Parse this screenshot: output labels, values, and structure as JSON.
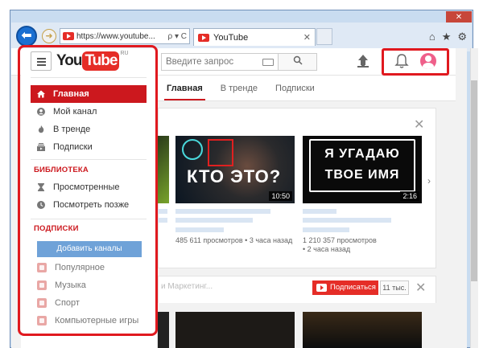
{
  "browser": {
    "url": "https://www.youtube...",
    "tab_title": "YouTube",
    "tab_close": "✕",
    "back": "⬅",
    "forward": "➜",
    "addr_icons": "ρ ▾ C",
    "right_icons": [
      "⌂",
      "★",
      "⚙"
    ]
  },
  "header": {
    "logo_you": "You",
    "logo_tube": "Tube",
    "logo_region": "RU",
    "search_placeholder": "Введите запрос"
  },
  "content_tabs": [
    {
      "label": "Главная",
      "active": true
    },
    {
      "label": "В тренде",
      "active": false
    },
    {
      "label": "Подписки",
      "active": false
    }
  ],
  "sidebar": {
    "main": [
      {
        "label": "Главная",
        "icon": "home-icon",
        "active": true
      },
      {
        "label": "Мой канал",
        "icon": "account-icon",
        "active": false
      },
      {
        "label": "В тренде",
        "icon": "flame-icon",
        "active": false
      },
      {
        "label": "Подписки",
        "icon": "subscriptions-icon",
        "active": false
      }
    ],
    "library_title": "БИБЛИОТЕКА",
    "library": [
      {
        "label": "Просмотренные",
        "icon": "hourglass-icon"
      },
      {
        "label": "Посмотреть позже",
        "icon": "clock-icon"
      }
    ],
    "subs_title": "ПОДПИСКИ",
    "add_channels": "Добавить каналы",
    "subscriptions": [
      {
        "label": "Популярное",
        "icon": "star-icon"
      },
      {
        "label": "Музыка",
        "icon": "music-icon"
      },
      {
        "label": "Спорт",
        "icon": "sport-icon"
      },
      {
        "label": "Компьютерные игры",
        "icon": "gamepad-icon"
      }
    ]
  },
  "videos": [
    {
      "duration": "",
      "views": "",
      "age": ""
    },
    {
      "duration": "10:50",
      "overlay": "КТО ЭТО?",
      "views": "485 611 просмотров",
      "age": "3 часа назад"
    },
    {
      "duration": "2:16",
      "overlay_line1": "Я УГАДАЮ",
      "overlay_line2": "ТВОЕ ИМЯ",
      "views": "1 210 357 просмотров",
      "age": "2 часа назад"
    }
  ],
  "channel_row": {
    "subscribe": "Подписаться",
    "count": "11 тыс.",
    "name": "и Маркетинг..."
  },
  "close_glyph": "✕",
  "colors": {
    "brand_red": "#e52d27",
    "active_red": "#cc181e",
    "highlight": "#e0191f"
  }
}
